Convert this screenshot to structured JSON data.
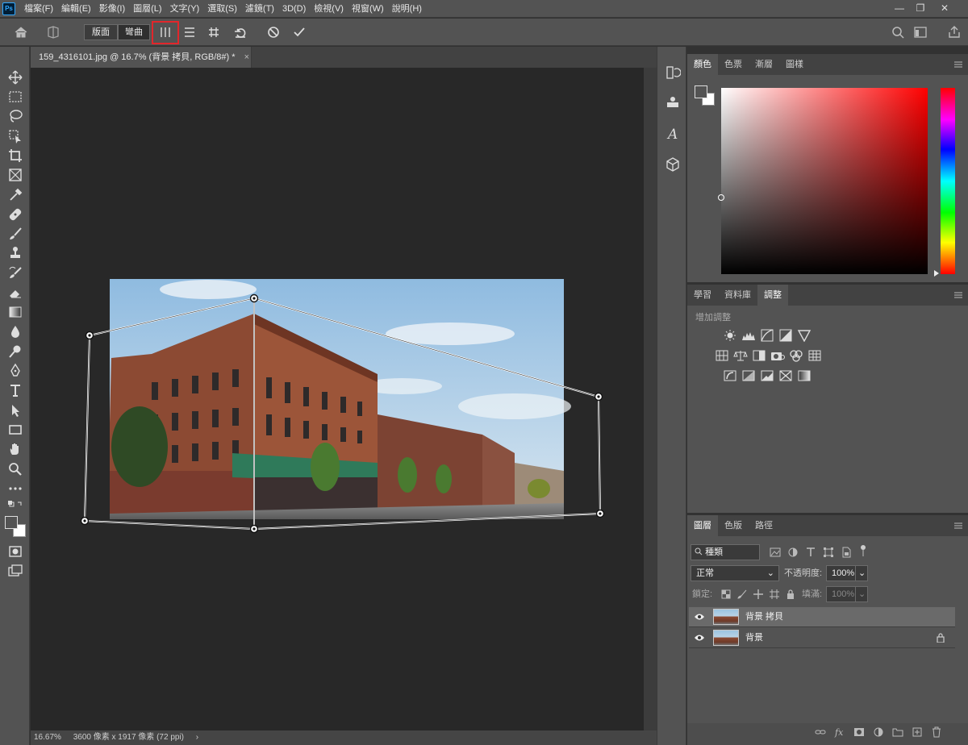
{
  "app": {
    "logo": "Ps"
  },
  "menu": [
    "檔案(F)",
    "編輯(E)",
    "影像(I)",
    "圖層(L)",
    "文字(Y)",
    "選取(S)",
    "濾鏡(T)",
    "3D(D)",
    "檢視(V)",
    "視窗(W)",
    "說明(H)"
  ],
  "window_controls": {
    "minimize": "—",
    "restore": "❐",
    "close": "✕"
  },
  "options_bar": {
    "mode_layout": "版面",
    "mode_warp": "彎曲",
    "highlighted_tool": "automatically-straighten-near-vertical-lines-icon"
  },
  "document": {
    "tab_title": "159_4316101.jpg @ 16.7% (背景 拷貝, RGB/8#) *",
    "close": "×"
  },
  "status": {
    "zoom": "16.67%",
    "size": "3600 像素 x 1917 像素 (72 ppi)",
    "arrow": "›"
  },
  "color_panel": {
    "tabs": [
      "顏色",
      "色票",
      "漸層",
      "圖樣"
    ],
    "active": 0
  },
  "adjust_panel": {
    "tabs": [
      "學習",
      "資料庫",
      "調整"
    ],
    "active": 2,
    "heading": "增加調整"
  },
  "layers_panel": {
    "tabs": [
      "圖層",
      "色版",
      "路徑"
    ],
    "active": 0,
    "filter_kind": "種類",
    "blend_mode": "正常",
    "opacity_label": "不透明度:",
    "opacity_value": "100%",
    "lock_label": "鎖定:",
    "fill_label": "填滿:",
    "fill_value": "100%",
    "layers": [
      {
        "name": "背景 拷貝",
        "selected": true,
        "locked": false
      },
      {
        "name": "背景",
        "selected": false,
        "locked": true
      }
    ]
  },
  "colors": {
    "accent_highlight": "#e2262b",
    "selected_layer": "#6a6a6a"
  }
}
